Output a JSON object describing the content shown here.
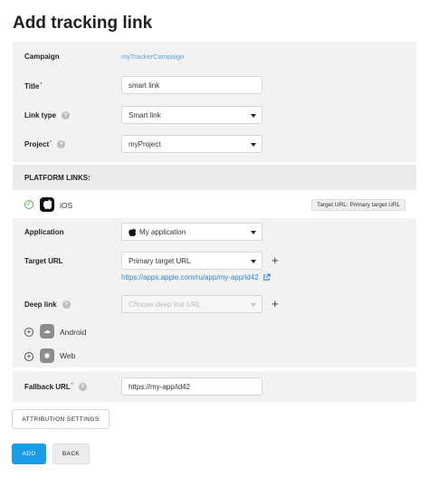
{
  "page": {
    "title": "Add tracking link"
  },
  "campaign": {
    "label": "Campaign",
    "value": "myTrackerCampaign"
  },
  "title_field": {
    "label": "Title",
    "required_mark": "*",
    "value": "smart link"
  },
  "link_type": {
    "label": "Link type",
    "help": "?",
    "value": "Smart link"
  },
  "project": {
    "label": "Project",
    "required_mark": "*",
    "help": "?",
    "value": "myProject"
  },
  "platform_links": {
    "heading": "PLATFORM LINKS:",
    "ios": {
      "name": "iOS",
      "icon": "apple-icon",
      "status_icon": "check-icon",
      "target_tag": "Target URL: Primary target URL",
      "application": {
        "label": "Application",
        "value": "My application"
      },
      "target_url": {
        "label": "Target URL",
        "value": "Primary target URL",
        "store_url": "https://apps.apple.com/ru/app/my-app/id42"
      },
      "deep_link": {
        "label": "Deep link",
        "help": "?",
        "placeholder": "Choose deep link URL"
      }
    },
    "android": {
      "name": "Android",
      "icon": "android-icon"
    },
    "web": {
      "name": "Web",
      "icon": "globe-icon"
    }
  },
  "fallback_url": {
    "label": "Fallback URL",
    "required_mark": "*",
    "help": "?",
    "value": "https://my-app/id42"
  },
  "buttons": {
    "attribution": "ATTRIBUTION SETTINGS",
    "add": "ADD",
    "back": "BACK"
  },
  "symbols": {
    "check": "✓",
    "plus": "+",
    "expand": "+",
    "globe": "◉",
    "android": "☁"
  },
  "colors": {
    "accent": "#1c9be6",
    "link": "#2b85d4",
    "success": "#4caf50",
    "panel": "#f2f2f2"
  }
}
